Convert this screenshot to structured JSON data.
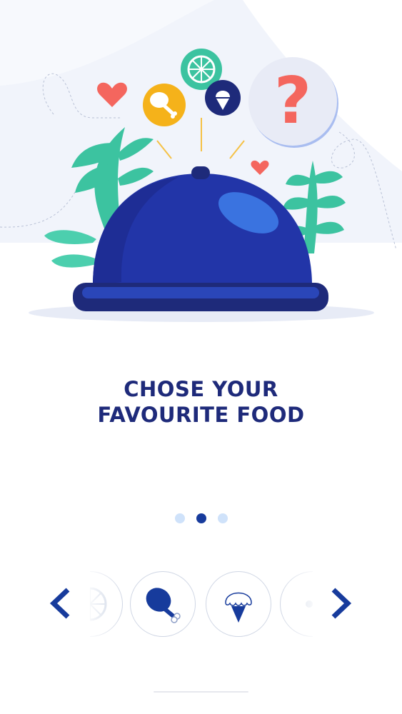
{
  "headline": {
    "line1": "CHOSE YOUR",
    "line2": "FAVOURITE FOOD"
  },
  "pager": {
    "total": 3,
    "active_index": 1
  },
  "carousel": {
    "items": [
      {
        "icon": "lemon-slice-icon"
      },
      {
        "icon": "chicken-leg-icon"
      },
      {
        "icon": "ice-cream-icon"
      },
      {
        "icon": "food-item-icon"
      }
    ],
    "prev_icon": "chevron-left-icon",
    "next_icon": "chevron-right-icon"
  },
  "illustration": {
    "bubbles": [
      "chicken-leg-icon",
      "lemon-slice-icon",
      "ice-cream-icon",
      "question-mark-icon"
    ],
    "question_mark": "?"
  },
  "colors": {
    "primary": "#1e2a7a",
    "accent_blue": "#173b9c",
    "cloche": "#2235a8",
    "leaf": "#3cc3a0",
    "heart": "#f4665e",
    "bubble_yellow": "#f5b21a"
  }
}
